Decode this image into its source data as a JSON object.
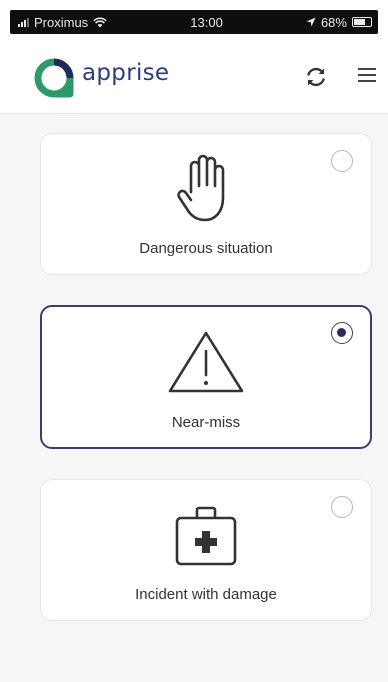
{
  "status_bar": {
    "carrier": "Proximus",
    "time": "13:00",
    "battery": "68%",
    "battery_level": 0.68
  },
  "header": {
    "app_name": "apprise",
    "brand_color": "#2c3e7a",
    "logo_colors": [
      "#2e9a6c",
      "#1d2a5c"
    ]
  },
  "options": [
    {
      "label": "Dangerous situation",
      "icon": "hand-stop-icon",
      "selected": false
    },
    {
      "label": "Near-miss",
      "icon": "warning-triangle-icon",
      "selected": true
    },
    {
      "label": "Incident with damage",
      "icon": "first-aid-kit-icon",
      "selected": false
    }
  ],
  "selected_color": "#3a3d6e"
}
